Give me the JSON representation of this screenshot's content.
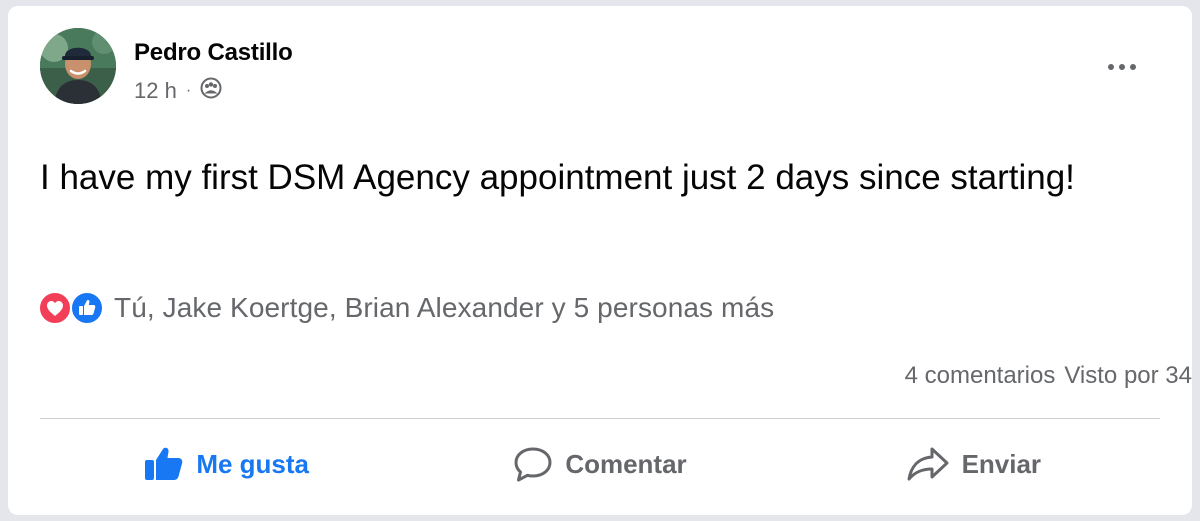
{
  "post": {
    "author": "Pedro Castillo",
    "time": "12 h",
    "separator": "·",
    "privacy_icon": "group-audience-icon",
    "text": "I have my first DSM Agency appointment just 2 days since starting!"
  },
  "reactions": {
    "icons": [
      "love-reaction-icon",
      "like-reaction-icon"
    ],
    "summary": "Tú, Jake Koertge, Brian Alexander y 5 personas más"
  },
  "stats": {
    "comments": "4 comentarios",
    "seen": "Visto por 34"
  },
  "actions": {
    "like": "Me gusta",
    "comment": "Comentar",
    "share": "Enviar"
  },
  "colors": {
    "like_blue": "#1877f2",
    "love_red": "#f33e58",
    "secondary_text": "#65676b",
    "divider": "#ced0d4"
  }
}
